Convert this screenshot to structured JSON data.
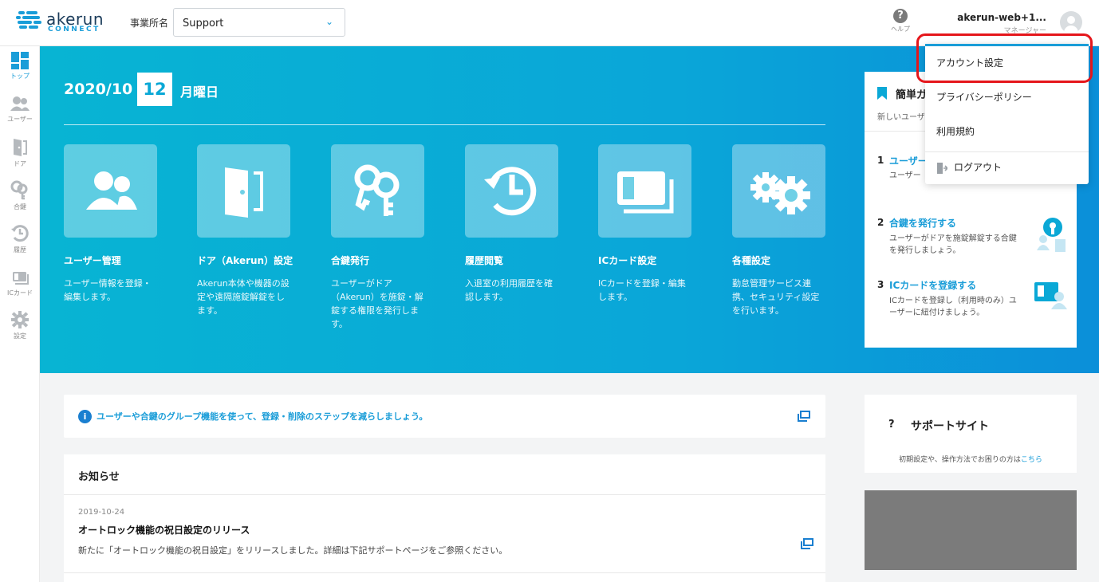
{
  "brand": {
    "name": "akerun",
    "sub": "CONNECT"
  },
  "header": {
    "office_label": "事業所名",
    "office_value": "Support",
    "help_label": "ヘルプ",
    "account_name": "akerun-web+1...",
    "account_role": "マネージャー"
  },
  "sidebar": {
    "items": [
      {
        "label": "トップ"
      },
      {
        "label": "ユーザー"
      },
      {
        "label": "ドア"
      },
      {
        "label": "合鍵"
      },
      {
        "label": "履歴"
      },
      {
        "label": "ICカード"
      },
      {
        "label": "設定"
      }
    ]
  },
  "hero": {
    "year_month": "2020/10",
    "day": "12",
    "weekday": "月曜日",
    "tiles": [
      {
        "title": "ユーザー管理",
        "desc": "ユーザー情報を登録・編集します。"
      },
      {
        "title": "ドア（Akerun）設定",
        "desc": "Akerun本体や機器の設定や遠隔施錠解錠をします。"
      },
      {
        "title": "合鍵発行",
        "desc": "ユーザーがドア（Akerun）を施錠・解錠する権限を発行します。"
      },
      {
        "title": "履歴閲覧",
        "desc": "入退室の利用履歴を確認します。"
      },
      {
        "title": "ICカード設定",
        "desc": "ICカードを登録・編集します。"
      },
      {
        "title": "各種設定",
        "desc": "勤怠管理サービス連携、セキュリティ設定を行います。"
      }
    ]
  },
  "guide": {
    "title": "簡単ガ",
    "subtitle": "新しいユーザ",
    "steps": [
      {
        "num": "1",
        "title": "ユーザー",
        "desc": "ユーザー"
      },
      {
        "num": "2",
        "title": "合鍵を発行する",
        "desc": "ユーザーがドアを施錠解錠する合鍵を発行しましょう。"
      },
      {
        "num": "3",
        "title": "ICカードを登録する",
        "desc": "ICカードを登録し（利用時のみ）ユーザーに紐付けましょう。"
      }
    ]
  },
  "dropdown": {
    "items": [
      {
        "label": "アカウント設定"
      },
      {
        "label": "プライバシーポリシー"
      },
      {
        "label": "利用規約"
      },
      {
        "label": "ログアウト"
      }
    ]
  },
  "info": {
    "text": "ユーザーや合鍵のグループ機能を使って、登録・削除のステップを減らしましょう。"
  },
  "news": {
    "title": "お知らせ",
    "items": [
      {
        "date": "2019-10-24",
        "title": "オートロック機能の祝日設定のリリース",
        "body": "新たに「オートロック機能の祝日設定」をリリースしました。詳細は下記サポートページをご参照ください。"
      }
    ]
  },
  "support": {
    "q": "?",
    "title": "サポートサイト",
    "text": "初期設定や、操作方法でお困りの方は",
    "link": "こちら"
  },
  "colors": {
    "accent": "#1a9dd8",
    "hero_start": "#08b4d3",
    "hero_end": "#0b8fd9",
    "highlight": "#e5161b"
  }
}
